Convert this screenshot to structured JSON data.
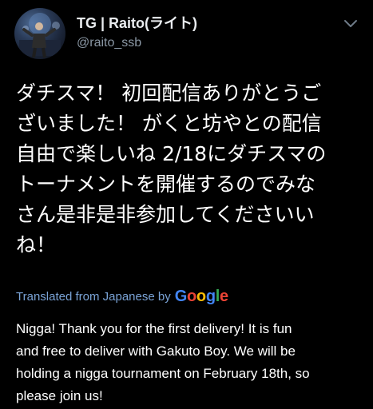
{
  "author": {
    "display_name": "TG | Raito(ライト)",
    "handle": "@raito_ssb"
  },
  "tweet": {
    "text_lines": [
      "ダチスマ！ 初回配信ありがとうご",
      "ざいました！ がくと坊やとの配信",
      "自由で楽しいね 2/18にダチスマの",
      "トーナメントを開催するのでみな",
      "さん是非是非参加してくださいい",
      "ね！"
    ]
  },
  "translation": {
    "label": "Translated from Japanese by",
    "provider": "Google",
    "text_lines": [
      "Nigga! Thank you for the first delivery! It is fun",
      "and free to deliver with Gakuto Boy. We will be",
      "holding a nigga tournament on February 18th, so",
      "please join us!"
    ]
  },
  "colors": {
    "background": "#000000",
    "text": "#ffffff",
    "secondary_text": "#8b98a5",
    "link_blue": "#7aa3d6"
  },
  "icons": {
    "more": "chevron-down-icon"
  }
}
